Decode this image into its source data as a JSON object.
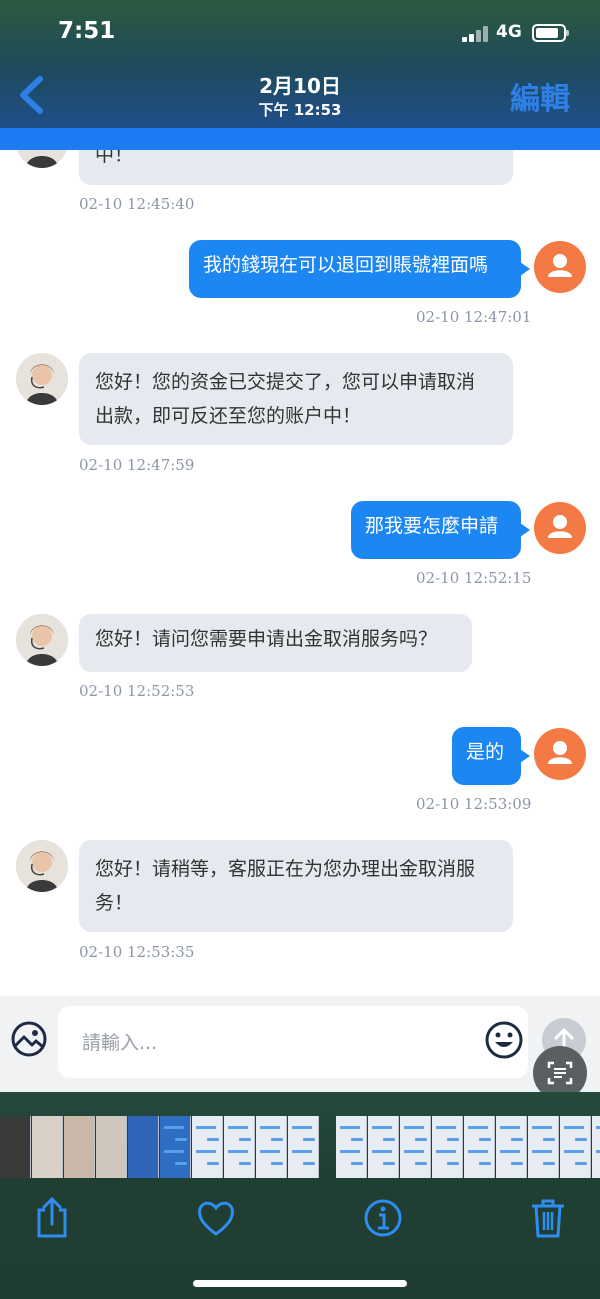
{
  "status_bar": {
    "time": "7:51",
    "network": "4G"
  },
  "nav": {
    "title": "2月10日",
    "subtitle": "下午 12:53",
    "edit_label": "編輯"
  },
  "chat": {
    "messages": [
      {
        "from": "agent",
        "lines": [
          "中！"
        ],
        "time": "02-10 12:45:40"
      },
      {
        "from": "user",
        "lines": [
          "我的錢現在可以退回到賬號裡面嗎"
        ],
        "time": "02-10 12:47:01"
      },
      {
        "from": "agent",
        "lines": [
          "您好！您的资金已交提交了，您可以申请取消",
          "出款，即可反还至您的账户中！"
        ],
        "time": "02-10 12:47:59"
      },
      {
        "from": "user",
        "lines": [
          "那我要怎麼申請"
        ],
        "time": "02-10 12:52:15"
      },
      {
        "from": "agent",
        "lines": [
          "您好！请问您需要申请出金取消服务吗？"
        ],
        "time": "02-10 12:52:53"
      },
      {
        "from": "user",
        "lines": [
          "是的"
        ],
        "time": "02-10 12:53:09"
      },
      {
        "from": "agent",
        "lines": [
          "您好！请稍等，客服正在为您办理出金取消服",
          "务！"
        ],
        "time": "02-10 12:53:35"
      }
    ]
  },
  "composer": {
    "placeholder": "請輸入..."
  },
  "icons": {
    "back": "chevron-left-icon",
    "image": "image-icon",
    "emoji": "smile-icon",
    "send": "arrow-up-icon",
    "scan": "live-text-icon",
    "share": "share-icon",
    "favorite": "heart-icon",
    "info": "info-icon",
    "delete": "trash-icon"
  },
  "colors": {
    "accent": "#1c87f2",
    "user_avatar": "#f47a45",
    "agent_bubble": "#e6eaf0",
    "edit": "#2f80e6"
  }
}
